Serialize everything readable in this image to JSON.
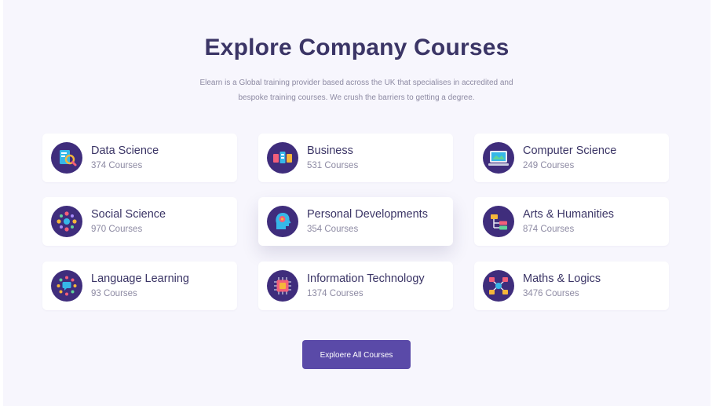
{
  "section": {
    "title": "Explore Company Courses",
    "description_line1": "Elearn is a Global training provider based across the UK that specialises in accredited and",
    "description_line2": "bespoke training courses. We crush the barriers to getting a degree."
  },
  "categories": [
    {
      "name": "Data Science",
      "count": "374 Courses",
      "icon": "data-science-icon"
    },
    {
      "name": "Business",
      "count": "531 Courses",
      "icon": "business-icon"
    },
    {
      "name": "Computer Science",
      "count": "249 Courses",
      "icon": "computer-icon"
    },
    {
      "name": "Social Science",
      "count": "970 Courses",
      "icon": "social-science-icon"
    },
    {
      "name": "Personal Developments",
      "count": "354 Courses",
      "icon": "personal-development-icon"
    },
    {
      "name": "Arts & Humanities",
      "count": "874 Courses",
      "icon": "arts-icon"
    },
    {
      "name": "Language Learning",
      "count": "93 Courses",
      "icon": "language-icon"
    },
    {
      "name": "Information Technology",
      "count": "1374 Courses",
      "icon": "chip-icon"
    },
    {
      "name": "Maths & Logics",
      "count": "3476 Courses",
      "icon": "maths-icon"
    }
  ],
  "cta": {
    "label": "Exploere All Courses"
  },
  "colors": {
    "brand": "#5a4aa8",
    "icon_bg": "#3f2d7c",
    "heading": "#3b3566",
    "muted": "#8d8aa3",
    "section_bg": "#f7f6fd"
  }
}
